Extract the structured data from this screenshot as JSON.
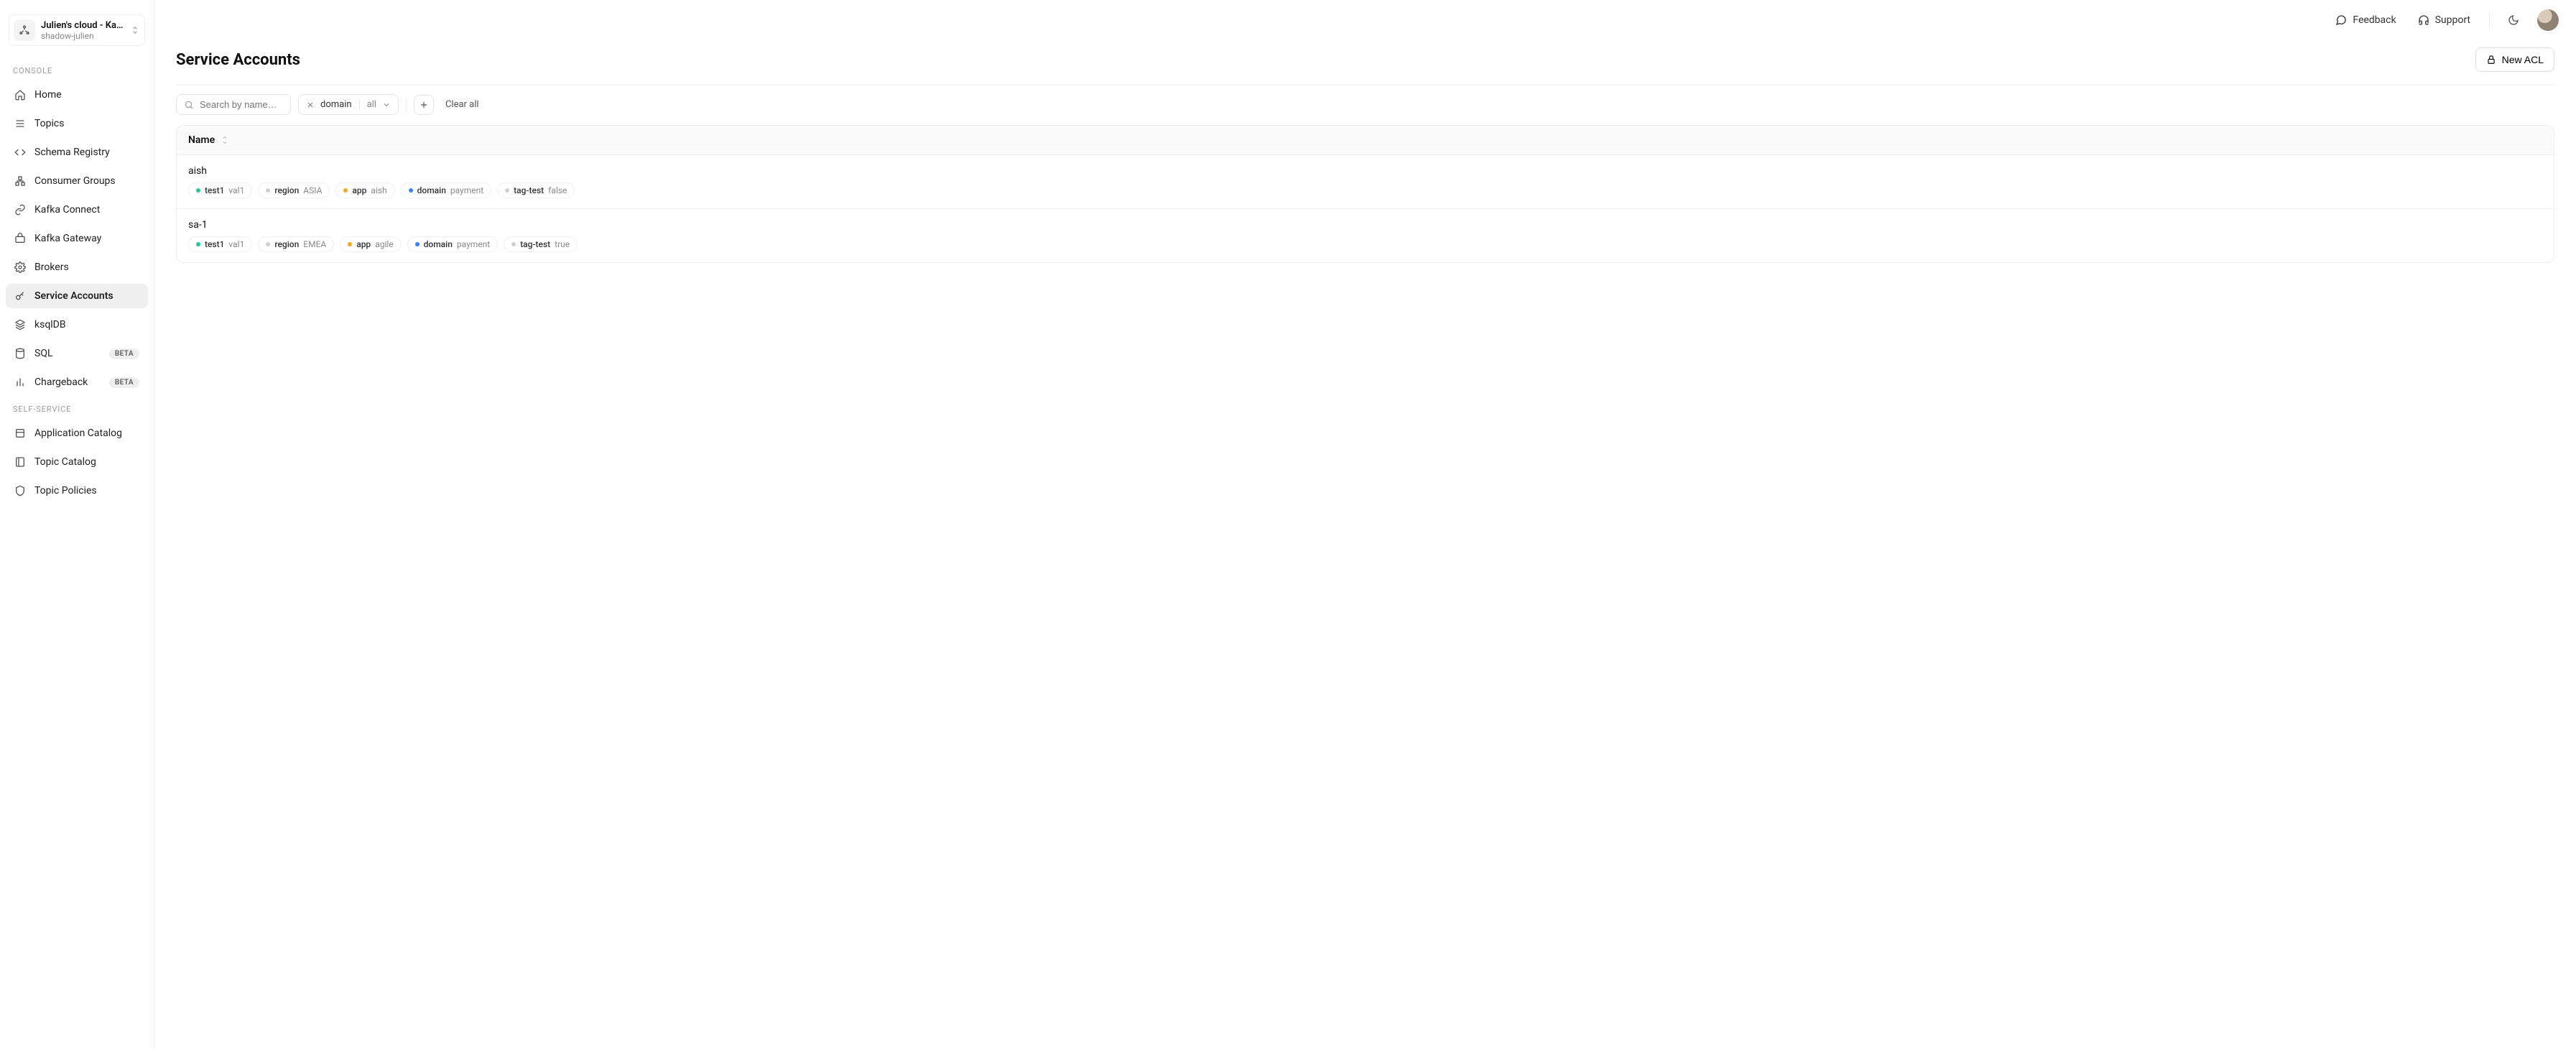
{
  "cluster": {
    "title": "Julien's cloud - Kafka",
    "subtitle": "shadow-julien"
  },
  "sidebar": {
    "sections": {
      "console": {
        "label": "CONSOLE"
      },
      "self_service": {
        "label": "SELF-SERVICE"
      }
    },
    "items": {
      "home": {
        "label": "Home"
      },
      "topics": {
        "label": "Topics"
      },
      "schema_registry": {
        "label": "Schema Registry"
      },
      "consumer_groups": {
        "label": "Consumer Groups"
      },
      "kafka_connect": {
        "label": "Kafka Connect"
      },
      "kafka_gateway": {
        "label": "Kafka Gateway"
      },
      "brokers": {
        "label": "Brokers"
      },
      "service_accounts": {
        "label": "Service Accounts"
      },
      "ksqldb": {
        "label": "ksqlDB"
      },
      "sql": {
        "label": "SQL",
        "badge": "BETA"
      },
      "chargeback": {
        "label": "Chargeback",
        "badge": "BETA"
      },
      "application_catalog": {
        "label": "Application Catalog"
      },
      "topic_catalog": {
        "label": "Topic Catalog"
      },
      "topic_policies": {
        "label": "Topic Policies"
      }
    }
  },
  "topbar": {
    "feedback": "Feedback",
    "support": "Support"
  },
  "page": {
    "title": "Service Accounts",
    "new_acl": "New ACL"
  },
  "filters": {
    "search_placeholder": "Search by name…",
    "clear_all": "Clear all",
    "chips": [
      {
        "label": "domain",
        "value": "all"
      }
    ]
  },
  "table": {
    "header": {
      "name": "Name"
    },
    "rows": [
      {
        "name": "aish",
        "tags": [
          {
            "key": "test1",
            "value": "val1",
            "color": "#20c997"
          },
          {
            "key": "region",
            "value": "ASIA",
            "color": "#cfcfcf"
          },
          {
            "key": "app",
            "value": "aish",
            "color": "#f5a623"
          },
          {
            "key": "domain",
            "value": "payment",
            "color": "#3b82f6"
          },
          {
            "key": "tag-test",
            "value": "false",
            "color": "#cfcfcf"
          }
        ]
      },
      {
        "name": "sa-1",
        "tags": [
          {
            "key": "test1",
            "value": "val1",
            "color": "#20c997"
          },
          {
            "key": "region",
            "value": "EMEA",
            "color": "#cfcfcf"
          },
          {
            "key": "app",
            "value": "agile",
            "color": "#f5a623"
          },
          {
            "key": "domain",
            "value": "payment",
            "color": "#3b82f6"
          },
          {
            "key": "tag-test",
            "value": "true",
            "color": "#cfcfcf"
          }
        ]
      }
    ]
  }
}
